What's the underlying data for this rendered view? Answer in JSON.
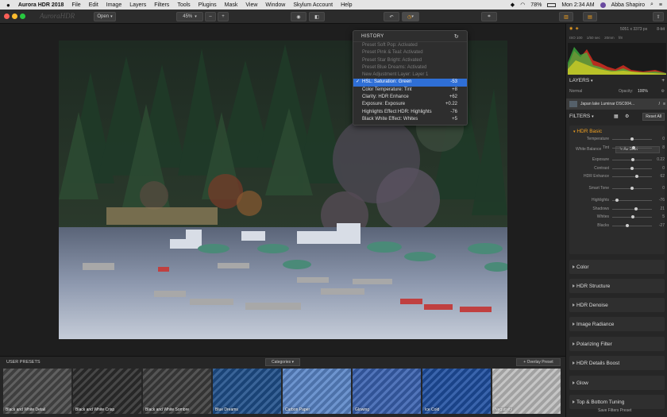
{
  "menubar": {
    "app_name": "Aurora HDR 2018",
    "items": [
      "File",
      "Edit",
      "Image",
      "Layers",
      "Filters",
      "Tools",
      "Plugins",
      "Mask",
      "View",
      "Window",
      "Skylum Account",
      "Help"
    ],
    "battery": "78%",
    "datetime": "Mon 2:34 AM",
    "user": "Abba Shapiro"
  },
  "toolbar": {
    "open_label": "Open",
    "zoom_value": "45%",
    "logo_text": "AuroraHDR"
  },
  "history": {
    "title": "HISTORY",
    "items": [
      {
        "label": "Preset Soft Pop: Activated",
        "value": ""
      },
      {
        "label": "Preset Pink & Teal: Activated",
        "value": ""
      },
      {
        "label": "Preset Star Bright: Activated",
        "value": ""
      },
      {
        "label": "Preset Blue Dreams: Activated",
        "value": ""
      },
      {
        "label": "New Adjustment Layer: Layer 1",
        "value": ""
      },
      {
        "label": "HSL: Saturation: Green",
        "value": "-53"
      },
      {
        "label": "Color Temperature: Tint",
        "value": "+8"
      },
      {
        "label": "Clarity: HDR Enhance",
        "value": "+62"
      },
      {
        "label": "Exposure: Exposure",
        "value": "+0.22"
      },
      {
        "label": "Highlights Effect HDR: Highlights",
        "value": "-76"
      },
      {
        "label": "Black White Effect: Whites",
        "value": "+5"
      }
    ]
  },
  "info": {
    "dimensions": "5051 x 3373 px",
    "bit_depth": "8-bit",
    "iso": "ISO 100",
    "shutter": "1/50 sec",
    "focal": "f/8",
    "lens": "20mm"
  },
  "layers": {
    "title": "LAYERS",
    "blend_mode": "Normal",
    "opacity_label": "Opacity:",
    "opacity_value": "100%",
    "layer_name": "Japan lake Luminar DSC004..."
  },
  "filters": {
    "title": "FILTERS",
    "reset_label": "Reset All",
    "hdr_basic": "HDR Basic",
    "white_balance_label": "White Balance",
    "white_balance_value": "As Shot",
    "sliders": [
      {
        "label": "Temperature",
        "value": "0",
        "level": 0.5
      },
      {
        "label": "Tint",
        "value": "8",
        "level": 0.54
      },
      {
        "label": "Exposure",
        "value": "0.22",
        "level": 0.52
      },
      {
        "label": "Contrast",
        "value": "0",
        "level": 0.5
      },
      {
        "label": "HDR Enhance",
        "value": "62",
        "level": 0.62
      },
      {
        "label": "Smart Tone",
        "value": "0",
        "level": 0.5
      },
      {
        "label": "Highlights",
        "value": "-76",
        "level": 0.12
      },
      {
        "label": "Shadows",
        "value": "21",
        "level": 0.6
      },
      {
        "label": "Whites",
        "value": "5",
        "level": 0.52
      },
      {
        "label": "Blacks",
        "value": "-27",
        "level": 0.37
      }
    ],
    "sections": [
      "Color",
      "HDR Structure",
      "HDR Denoise",
      "Image Radiance",
      "Polarizing Filter",
      "HDR Details Boost",
      "Glow",
      "Top & Bottom Tuning"
    ],
    "save_label": "Save Filters Preset"
  },
  "presets": {
    "title": "USER PRESETS",
    "categories_label": "Categories",
    "overlay_label": "+ Overlay Preset",
    "items": [
      {
        "name": "Black and White Detail",
        "color": "#4a4a4a"
      },
      {
        "name": "Black and White Crisp",
        "color": "#2e2e2e"
      },
      {
        "name": "Black and White Sombre",
        "color": "#3d3d3d"
      },
      {
        "name": "Blue Dreams",
        "color": "#1f4f8a"
      },
      {
        "name": "Carbon Paper",
        "color": "#5a86c8"
      },
      {
        "name": "Glowing",
        "color": "#3a62b0"
      },
      {
        "name": "Ice Cold",
        "color": "#1f4fa0"
      },
      {
        "name": "Negativity",
        "color": "#bdbdbd"
      }
    ]
  }
}
